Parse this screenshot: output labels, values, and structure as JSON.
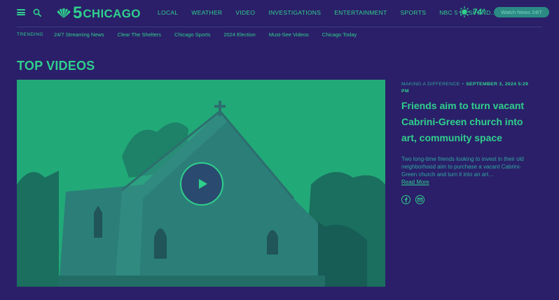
{
  "header": {
    "logo_number": "5",
    "logo_text": "CHICAGO",
    "nav": [
      "LOCAL",
      "WEATHER",
      "VIDEO",
      "INVESTIGATIONS",
      "ENTERTAINMENT",
      "SPORTS",
      "NBC 5 RESPOND..."
    ],
    "temperature": "74°",
    "watch_label": "Watch News 24/7"
  },
  "trending": {
    "label": "TRENDING",
    "items": [
      "24/7 Streaming News",
      "Clear The Shelters",
      "Chicago Sports",
      "2024 Election",
      "Must-See Videos",
      "Chicago Today"
    ]
  },
  "section": {
    "title": "TOP VIDEOS"
  },
  "article": {
    "category": "MAKING A DIFFERENCE",
    "separator": "•",
    "date": "SEPTEMBER 3, 2024 5:29 PM",
    "headline": "Friends aim to turn vacant Cabrini-Green church into art, community space",
    "summary": "Two long-time friends looking to invest in their old neighborhood aim to purchase a vacant Cabrini-Green church and turn it into an art…",
    "read_more": "Read More"
  },
  "icons": {
    "menu": "hamburger-menu-icon",
    "search": "search-icon",
    "weather": "sun-icon",
    "play": "play-icon",
    "share": [
      "facebook-icon",
      "email-icon"
    ]
  },
  "colors": {
    "background": "#2b1f69",
    "accent": "#2fd08c",
    "muted": "#2fa9a0",
    "button": "#2b8a84"
  }
}
